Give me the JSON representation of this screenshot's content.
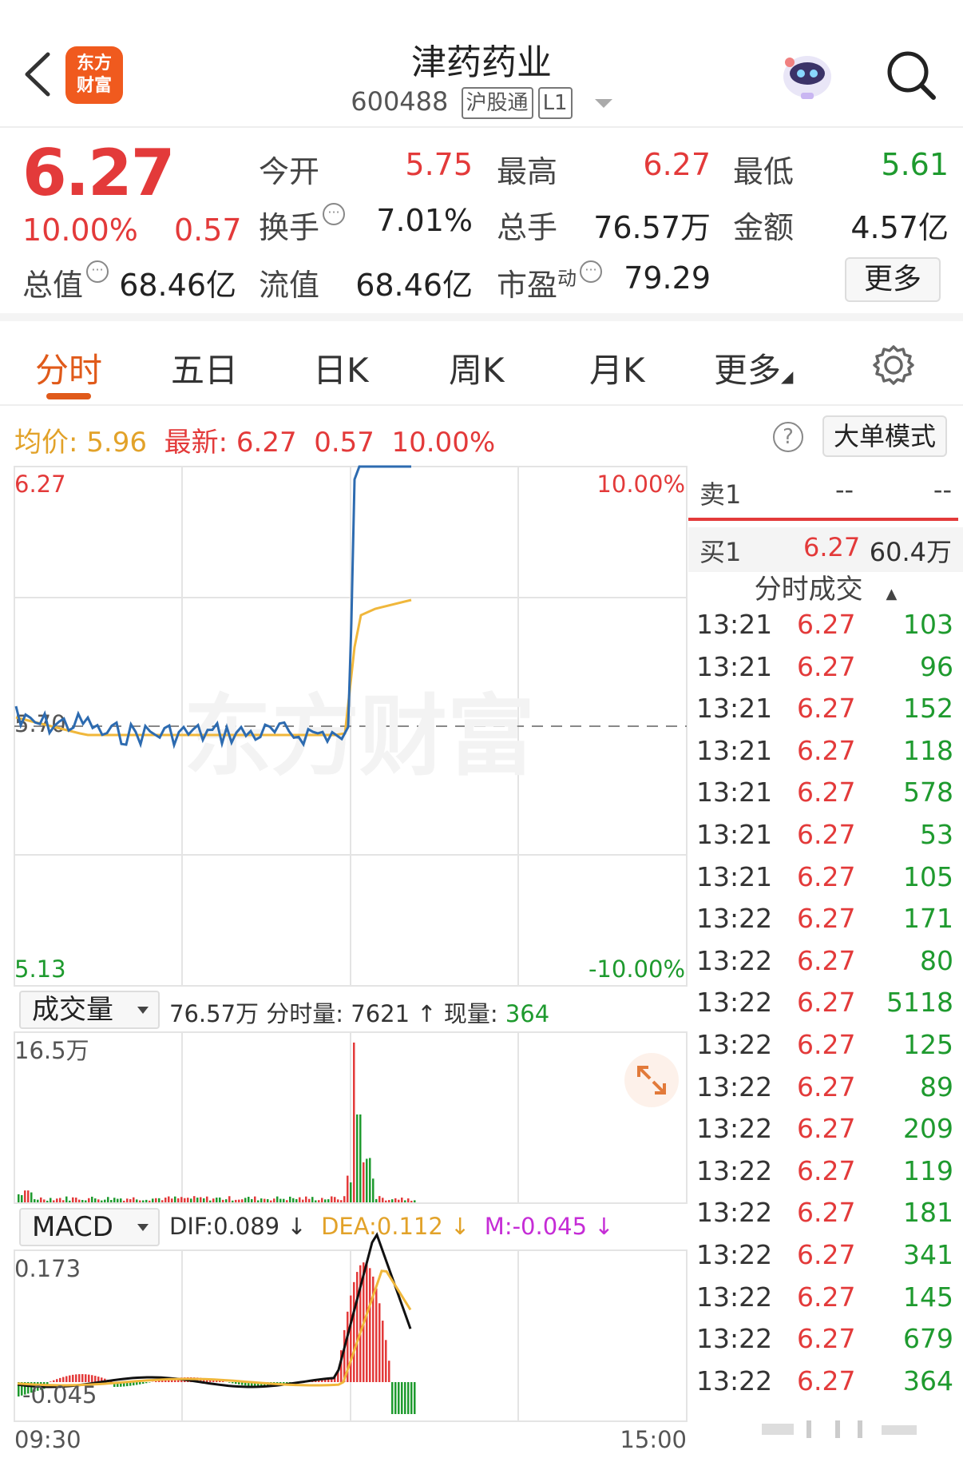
{
  "header": {
    "logo_line1": "东方",
    "logo_line2": "财富",
    "stock_name": "津药药业",
    "stock_code": "600488",
    "tag_connect": "沪股通",
    "tag_level": "L1"
  },
  "quote": {
    "price": "6.27",
    "change_pct": "10.00%",
    "change": "0.57",
    "fields": [
      {
        "label": "今开",
        "value": "5.75",
        "color": "red"
      },
      {
        "label": "最高",
        "value": "6.27",
        "color": "red"
      },
      {
        "label": "最低",
        "value": "5.61",
        "color": "green"
      },
      {
        "label": "换手",
        "value": "7.01%",
        "color": "dark"
      },
      {
        "label": "总手",
        "value": "76.57万",
        "color": "dark"
      },
      {
        "label": "金额",
        "value": "4.57亿",
        "color": "dark"
      },
      {
        "label": "总值",
        "value": "68.46亿",
        "color": "dark"
      },
      {
        "label": "流值",
        "value": "68.46亿",
        "color": "dark"
      },
      {
        "label": "市盈",
        "label_sup": "动",
        "value": "79.29",
        "color": "dark"
      }
    ],
    "more_label": "更多"
  },
  "tabs": [
    {
      "label": "分时",
      "active": true
    },
    {
      "label": "五日",
      "active": false
    },
    {
      "label": "日K",
      "active": false
    },
    {
      "label": "周K",
      "active": false
    },
    {
      "label": "月K",
      "active": false
    },
    {
      "label": "更多",
      "active": false
    }
  ],
  "summary": {
    "avg_label": "均价:",
    "avg_value": "5.96",
    "latest_label": "最新:",
    "latest_value": "6.27",
    "latest_change": "0.57",
    "latest_pct": "10.00%",
    "help_glyph": "?",
    "big_order_label": "大单模式"
  },
  "price_chart": {
    "y_top_label": "6.27",
    "y_mid_label": "5.70",
    "y_bottom_label": "5.13",
    "pct_top_label": "10.00%",
    "pct_bottom_label": "-10.00%",
    "watermark": "东方财富",
    "colors": {
      "price": "#2d6bb0",
      "avg": "#f0b73b",
      "up": "#e33a3a",
      "down": "#1e9a2e"
    }
  },
  "volume": {
    "select_label": "成交量",
    "total": "76.57万",
    "minute_label": "分时量:",
    "minute_value": "7621",
    "arrow": "↑",
    "current_label": "现量:",
    "current_value": "364",
    "y_top_label": "16.5万"
  },
  "macd": {
    "select_label": "MACD",
    "dif": "DIF:0.089 ↓",
    "dea": "DEA:0.112 ↓",
    "m": "M:-0.045 ↓",
    "y_top_label": "0.173",
    "y_bottom_label": "-0.045"
  },
  "time_axis": {
    "start": "09:30",
    "end": "15:00"
  },
  "order_book": {
    "sell1_label": "卖1",
    "sell1_price": "--",
    "sell1_volume": "--",
    "buy1_label": "买1",
    "buy1_price": "6.27",
    "buy1_volume": "60.4万"
  },
  "trades_title": "分时成交",
  "trades": [
    {
      "time": "13:21",
      "price": "6.27",
      "volume": "103"
    },
    {
      "time": "13:21",
      "price": "6.27",
      "volume": "96"
    },
    {
      "time": "13:21",
      "price": "6.27",
      "volume": "152"
    },
    {
      "time": "13:21",
      "price": "6.27",
      "volume": "118"
    },
    {
      "time": "13:21",
      "price": "6.27",
      "volume": "578"
    },
    {
      "time": "13:21",
      "price": "6.27",
      "volume": "53"
    },
    {
      "time": "13:21",
      "price": "6.27",
      "volume": "105"
    },
    {
      "time": "13:22",
      "price": "6.27",
      "volume": "171"
    },
    {
      "time": "13:22",
      "price": "6.27",
      "volume": "80"
    },
    {
      "time": "13:22",
      "price": "6.27",
      "volume": "5118"
    },
    {
      "time": "13:22",
      "price": "6.27",
      "volume": "125"
    },
    {
      "time": "13:22",
      "price": "6.27",
      "volume": "89"
    },
    {
      "time": "13:22",
      "price": "6.27",
      "volume": "209"
    },
    {
      "time": "13:22",
      "price": "6.27",
      "volume": "119"
    },
    {
      "time": "13:22",
      "price": "6.27",
      "volume": "181"
    },
    {
      "time": "13:22",
      "price": "6.27",
      "volume": "341"
    },
    {
      "time": "13:22",
      "price": "6.27",
      "volume": "145"
    },
    {
      "time": "13:22",
      "price": "6.27",
      "volume": "679"
    },
    {
      "time": "13:22",
      "price": "6.27",
      "volume": "364"
    }
  ]
}
